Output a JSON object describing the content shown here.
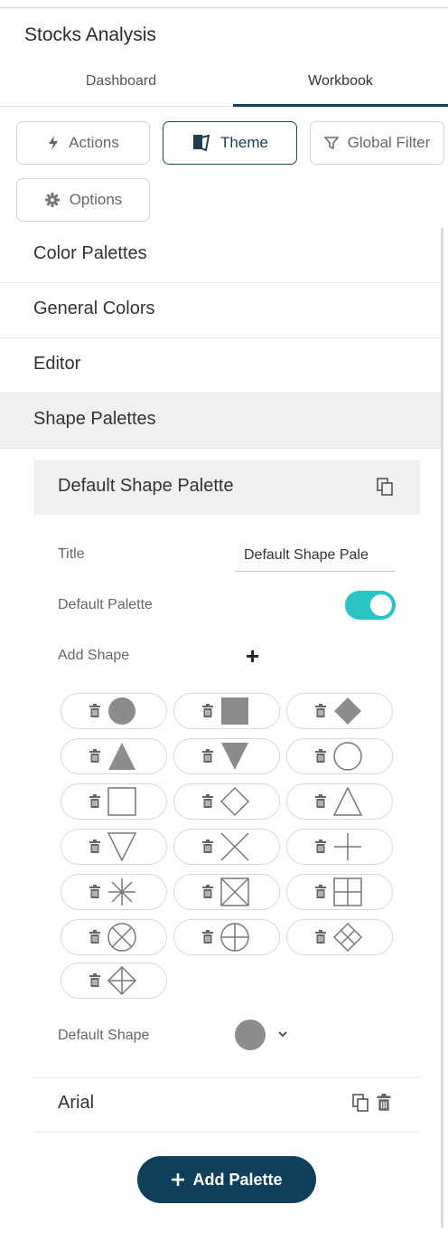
{
  "app": {
    "title": "Stocks Analysis"
  },
  "tabs": [
    {
      "label": "Dashboard",
      "active": false
    },
    {
      "label": "Workbook",
      "active": true
    }
  ],
  "toolbar": {
    "actions_label": "Actions",
    "theme_label": "Theme",
    "global_filter_label": "Global Filter",
    "options_label": "Options"
  },
  "sections": {
    "color_palettes": "Color Palettes",
    "general_colors": "General Colors",
    "editor": "Editor",
    "shape_palettes": "Shape Palettes"
  },
  "palette": {
    "name": "Default Shape Palette",
    "title_label": "Title",
    "title_value": "Default Shape Pale",
    "default_palette_label": "Default Palette",
    "default_palette_on": true,
    "add_shape_label": "Add Shape",
    "default_shape_label": "Default Shape",
    "default_shape": "filled-circle",
    "shapes": [
      "filled-circle",
      "filled-square",
      "filled-diamond",
      "filled-triangle-up",
      "filled-triangle-down",
      "circle",
      "square",
      "diamond",
      "triangle-up",
      "triangle-down",
      "x",
      "plus",
      "asterisk",
      "square-x",
      "square-plus",
      "circle-x",
      "circle-plus",
      "diamond-x",
      "diamond-plus"
    ]
  },
  "second_palette": {
    "name": "Arial"
  },
  "add_palette": {
    "label": "Add Palette"
  },
  "colors": {
    "accent": "#0f3f5a",
    "toggle_on": "#2bc4c6",
    "shape_gray": "#8c8c8c"
  }
}
